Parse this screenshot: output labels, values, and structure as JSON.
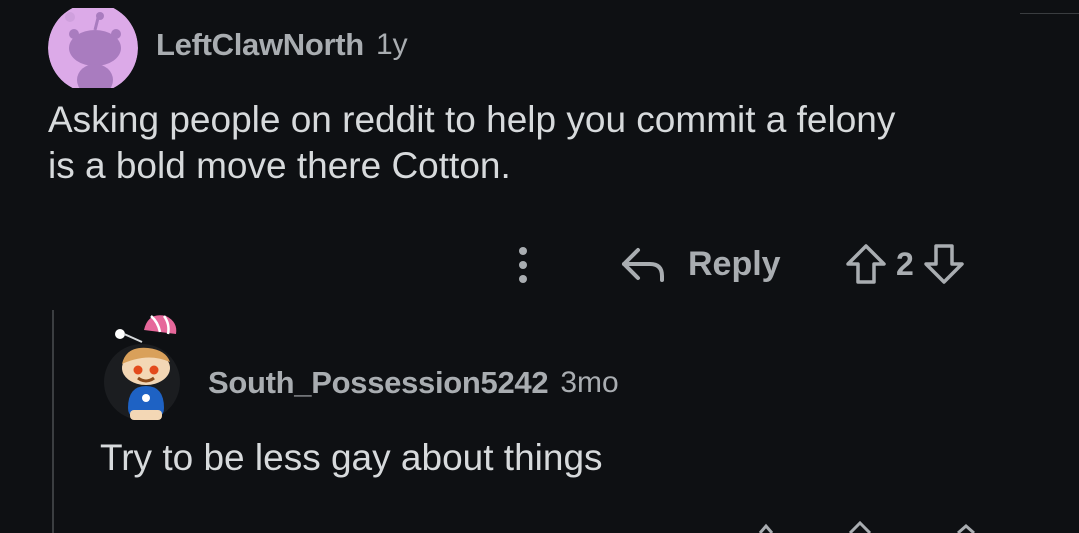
{
  "comments": [
    {
      "username": "LeftClawNorth",
      "age": "1y",
      "body": "Asking people on reddit to help you commit a felony\nis a bold move there Cotton.",
      "actions": {
        "reply_label": "Reply",
        "score": "2"
      }
    },
    {
      "username": "South_Possession5242",
      "age": "3mo",
      "body": "Try to be less gay about things"
    }
  ],
  "colors": {
    "background": "#0e1013",
    "text": "#d7dadc",
    "muted": "#a9adb1",
    "avatar_bg": "#dcaae8"
  },
  "icons": {
    "more": "vertical-ellipsis-icon",
    "reply": "reply-arrow-icon",
    "upvote": "upvote-arrow-icon",
    "downvote": "downvote-arrow-icon"
  }
}
